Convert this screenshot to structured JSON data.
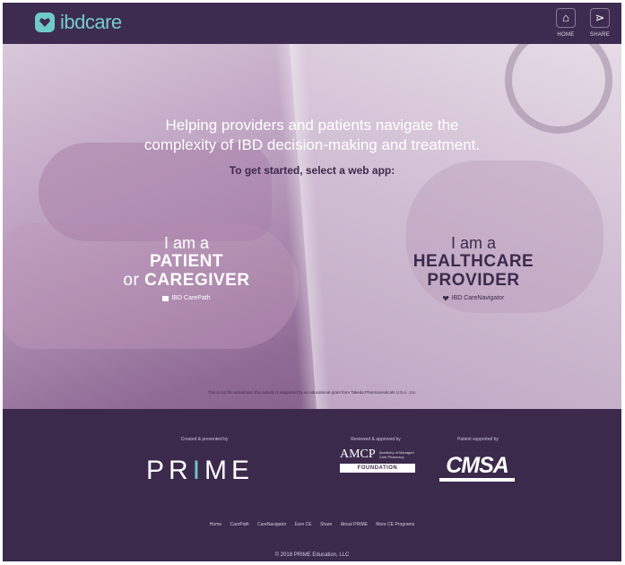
{
  "header": {
    "logo_text": "ibdcare",
    "home_label": "HOME",
    "share_label": "SHARE",
    "home_icon": "home-icon",
    "share_icon": "share-icon"
  },
  "hero": {
    "tagline_line1": "Helping providers and patients navigate the",
    "tagline_line2": "complexity of IBD decision-making and treatment.",
    "cta": "To get started, select a web app:",
    "patient": {
      "pre": "I am a",
      "line1": "PATIENT",
      "or": "or",
      "line2": "CAREGIVER",
      "app": "IBD CarePath"
    },
    "provider": {
      "pre": "I am a",
      "line1": "HEALTHCARE",
      "line2": "PROVIDER",
      "app": "IBD CareNavigator"
    },
    "grant": "This is not the actual text; this activity is supported by an educational grant from Takeda Pharmaceuticals U.S.A., Inc."
  },
  "footer": {
    "created_label": "Created & presented by",
    "reviewed_label": "Reviewed & approved by",
    "supported_label": "Patient supported by",
    "prime_text": "PRIME",
    "amcp_mark": "AMCP",
    "amcp_desc": "Academy of Managed Care Pharmacy",
    "amcp_band": "FOUNDATION",
    "cmsa_text": "CMSA",
    "nav": [
      "Home",
      "CarePath",
      "CareNavigator",
      "Earn CE",
      "Share",
      "About PRIME",
      "More CE Programs"
    ],
    "copyright": "© 2018 PRIME Education, LLC"
  },
  "colors": {
    "brand_purple": "#3b2a4c",
    "accent_teal": "#6fc9c9"
  }
}
